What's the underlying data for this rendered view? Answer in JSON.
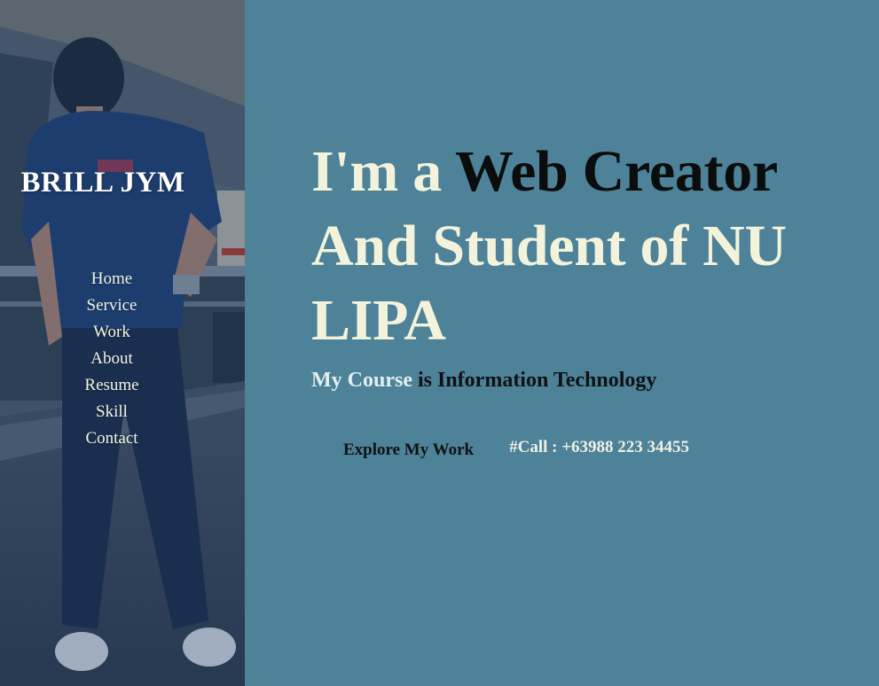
{
  "sidebar": {
    "brand": "BRILL JYM",
    "nav": [
      "Home",
      "Service",
      "Work",
      "About",
      "Resume",
      "Skill",
      "Contact"
    ]
  },
  "hero": {
    "title_prefix": "I'm a ",
    "title_accent": "Web Creator",
    "title_rest": " And Student of NU LIPA",
    "course_highlight": "My Course",
    "course_rest": " is Information Technology"
  },
  "actions": {
    "explore_label": "Explore My Work",
    "call_label": "#Call : +63988 223 34455"
  },
  "colors": {
    "background": "#4d8299",
    "title_text": "#f3f3dc",
    "accent_text": "#0b0c0c"
  }
}
